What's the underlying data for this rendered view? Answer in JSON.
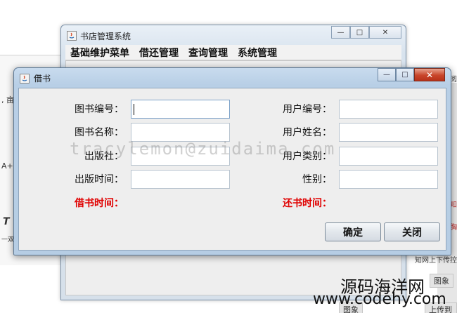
{
  "background": {
    "left_fragments": [
      ", 亩",
      "A+S",
      "T",
      "一双"
    ],
    "right_fragments": [
      "阅",
      "知",
      "胸",
      "知网上下传控"
    ],
    "tags": [
      "图象",
      "图象",
      "上传到服"
    ]
  },
  "main_window": {
    "title": "书店管理系统",
    "menu": [
      "基础维护菜单",
      "借还管理",
      "查询管理",
      "系统管理"
    ],
    "controls": {
      "minimize": "—",
      "maximize": "□",
      "close": "✕"
    }
  },
  "dialog": {
    "title": "借书",
    "controls": {
      "minimize": "—",
      "maximize": "□",
      "close": "✕"
    },
    "left_fields": [
      {
        "label": "图书编号：",
        "value": ""
      },
      {
        "label": "图书名称：",
        "value": ""
      },
      {
        "label": "出版社：",
        "value": ""
      },
      {
        "label": "出版时间：",
        "value": ""
      }
    ],
    "right_fields": [
      {
        "label": "用户编号：",
        "value": ""
      },
      {
        "label": "用户姓名：",
        "value": ""
      },
      {
        "label": "用户类别：",
        "value": ""
      },
      {
        "label": "性别：",
        "value": ""
      }
    ],
    "borrow_time_label": "借书时间：",
    "return_time_label": "还书时间：",
    "confirm_button": "确定",
    "close_button": "关闭"
  },
  "watermark": "tracylemon@zuidaima.com",
  "branding": {
    "line1": "源码海洋网",
    "line2": "www.codehy.com"
  },
  "colors": {
    "accent_red": "#e00000",
    "title_blue": "#b8cfe6",
    "close_red": "#c8452a"
  }
}
